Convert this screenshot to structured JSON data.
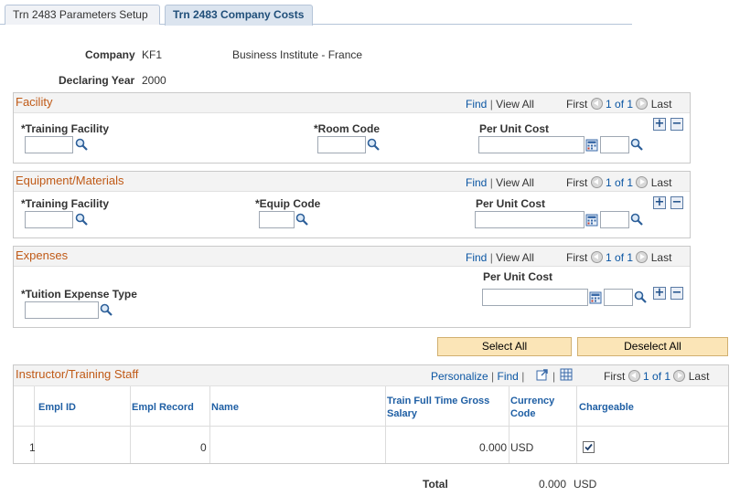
{
  "tabs": [
    {
      "label": "Trn 2483 Parameters Setup"
    },
    {
      "label": "Trn 2483 Company Costs"
    }
  ],
  "header": {
    "company_label": "Company",
    "company_code": "KF1",
    "company_name": "Business Institute - France",
    "year_label": "Declaring Year",
    "year_value": "2000"
  },
  "facility": {
    "title": "Facility",
    "find": "Find",
    "view_all": "View All",
    "first": "First",
    "count": "1 of 1",
    "last": "Last",
    "col1": "*Training Facility",
    "col2": "*Room Code",
    "col3": "Per Unit Cost",
    "training_facility_value": "",
    "room_code_value": "",
    "per_unit_cost_value": "",
    "currency_value": ""
  },
  "equipment": {
    "title": "Equipment/Materials",
    "find": "Find",
    "view_all": "View All",
    "first": "First",
    "count": "1 of 1",
    "last": "Last",
    "col1": "*Training Facility",
    "col2": "*Equip Code",
    "col3": "Per Unit Cost",
    "training_facility_value": "",
    "equip_code_value": "",
    "per_unit_cost_value": "",
    "currency_value": ""
  },
  "expenses": {
    "title": "Expenses",
    "find": "Find",
    "view_all": "View All",
    "first": "First",
    "count": "1 of 1",
    "last": "Last",
    "col1": "*Tuition Expense Type",
    "col2": "Per Unit Cost",
    "expense_type_value": "",
    "per_unit_cost_value": "",
    "currency_value": ""
  },
  "buttons": {
    "select_all": "Select All",
    "deselect_all": "Deselect All"
  },
  "staff": {
    "title": "Instructor/Training Staff",
    "personalize": "Personalize",
    "find": "Find",
    "first": "First",
    "count": "1 of 1",
    "last": "Last",
    "columns": {
      "empl_id": "Empl ID",
      "empl_record": "Empl Record",
      "name": "Name",
      "salary": "Train Full Time Gross Salary",
      "currency": "Currency Code",
      "chargeable": "Chargeable"
    },
    "rows": [
      {
        "num": "1",
        "empl_id": "",
        "empl_record": "0",
        "name": "",
        "salary": "0.000",
        "currency": "USD",
        "chargeable": true
      }
    ]
  },
  "total": {
    "label": "Total",
    "value": "0.000",
    "currency": "USD"
  },
  "colors": {
    "section_title": "#c05a17",
    "link": "#0b56a3",
    "button_bg": "#fbe5b7"
  }
}
